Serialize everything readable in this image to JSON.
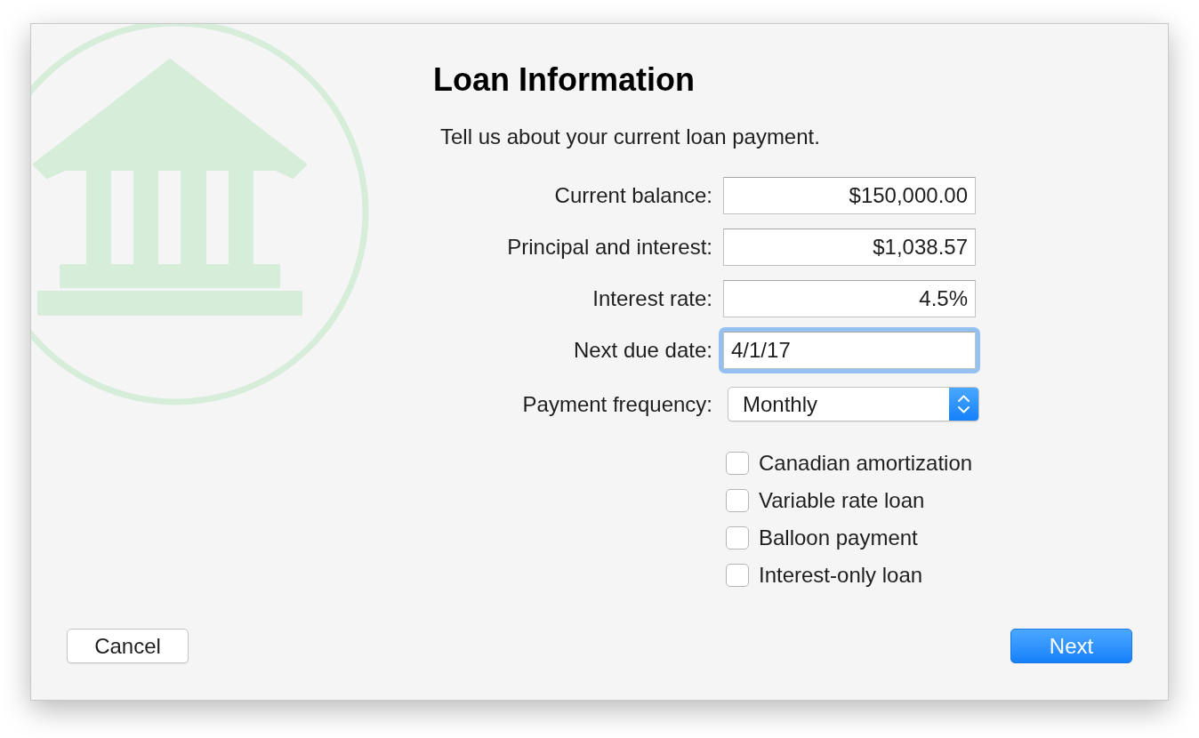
{
  "header": {
    "title": "Loan Information",
    "subtitle": "Tell us about your current loan payment."
  },
  "fields": [
    {
      "label": "Current balance:",
      "kind": "amount",
      "value": "$150,000.00",
      "focused": false
    },
    {
      "label": "Principal and interest:",
      "kind": "amount",
      "value": "$1,038.57",
      "focused": false
    },
    {
      "label": "Interest rate:",
      "kind": "amount",
      "value": "4.5%",
      "focused": false
    },
    {
      "label": "Next due date:",
      "kind": "date",
      "value": "4/1/17",
      "focused": true
    }
  ],
  "payment_frequency": {
    "label": "Payment frequency:",
    "value": "Monthly"
  },
  "options": [
    {
      "label": "Canadian amortization",
      "checked": false
    },
    {
      "label": "Variable rate loan",
      "checked": false
    },
    {
      "label": "Balloon payment",
      "checked": false
    },
    {
      "label": "Interest-only loan",
      "checked": false
    }
  ],
  "buttons": [
    {
      "label": "Cancel",
      "default": false
    },
    {
      "label": "Next",
      "default": true
    }
  ]
}
